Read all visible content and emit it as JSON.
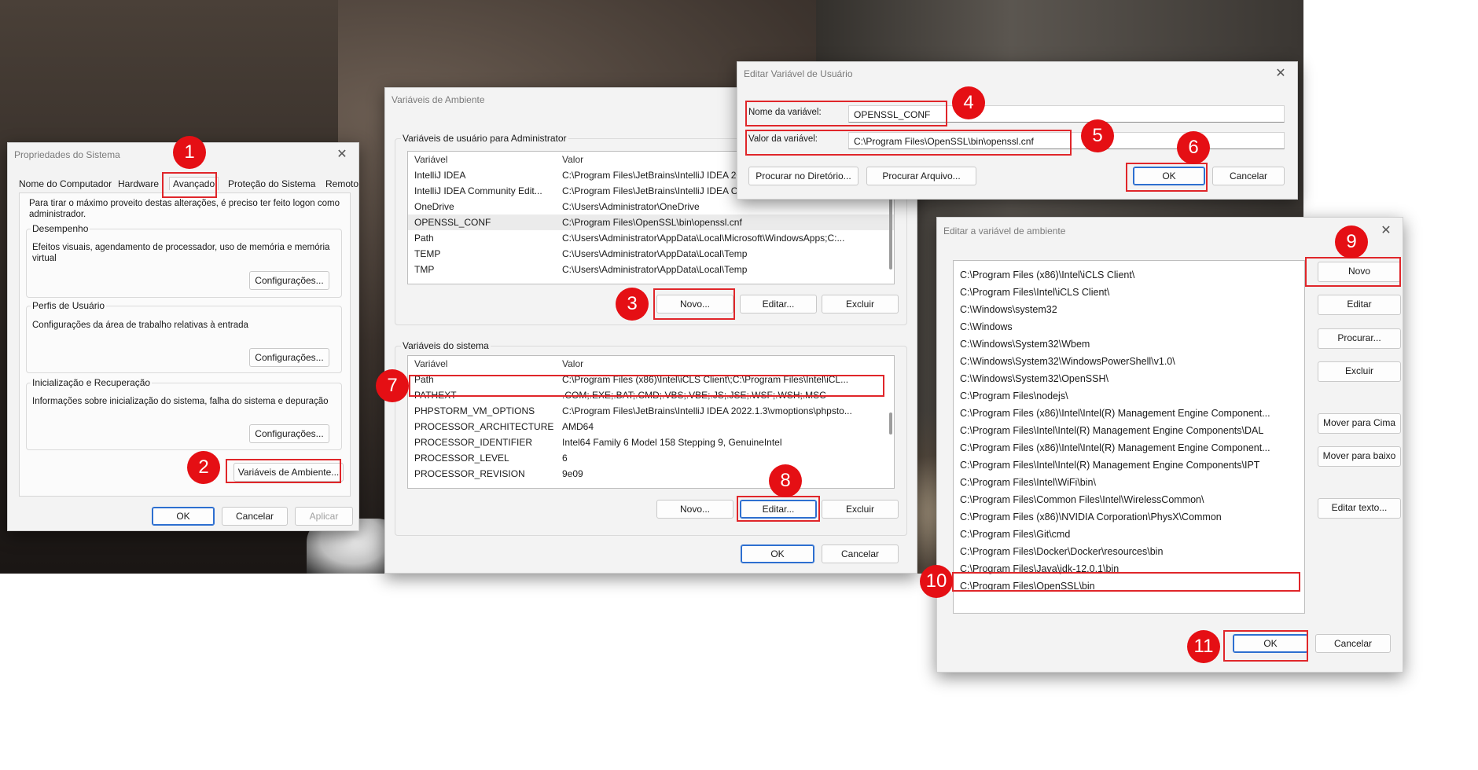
{
  "sys": {
    "title": "Propriedades do Sistema",
    "tabs": [
      "Nome do Computador",
      "Hardware",
      "Avançado",
      "Proteção do Sistema",
      "Remoto"
    ],
    "intro": "Para tirar o máximo proveito destas alterações, é preciso ter feito logon como administrador.",
    "perf_label": "Desempenho",
    "perf_desc": "Efeitos visuais, agendamento de processador, uso de memória e memória virtual",
    "profiles_label": "Perfis de Usuário",
    "profiles_desc": "Configurações da área de trabalho relativas à entrada",
    "startup_label": "Inicialização e Recuperação",
    "startup_desc": "Informações sobre inicialização do sistema, falha do sistema e depuração",
    "settings_btn": "Configurações...",
    "env_btn": "Variáveis de Ambiente...",
    "ok": "OK",
    "cancel": "Cancelar",
    "apply": "Aplicar"
  },
  "env": {
    "title": "Variáveis de Ambiente",
    "user_group": "Variáveis de usuário para Administrator",
    "col_var": "Variável",
    "col_val": "Valor",
    "user_vars": [
      {
        "name": "IntelliJ IDEA",
        "value": "C:\\Program Files\\JetBrains\\IntelliJ IDEA 2022.1.3\\bin;"
      },
      {
        "name": "IntelliJ IDEA Community Edit...",
        "value": "C:\\Program Files\\JetBrains\\IntelliJ IDEA Community Edition 2021.3.3\\bin;"
      },
      {
        "name": "OneDrive",
        "value": "C:\\Users\\Administrator\\OneDrive"
      },
      {
        "name": "OPENSSL_CONF",
        "value": "C:\\Program Files\\OpenSSL\\bin\\openssl.cnf"
      },
      {
        "name": "Path",
        "value": "C:\\Users\\Administrator\\AppData\\Local\\Microsoft\\WindowsApps;C:..."
      },
      {
        "name": "TEMP",
        "value": "C:\\Users\\Administrator\\AppData\\Local\\Temp"
      },
      {
        "name": "TMP",
        "value": "C:\\Users\\Administrator\\AppData\\Local\\Temp"
      }
    ],
    "system_group": "Variáveis do sistema",
    "system_vars": [
      {
        "name": "Path",
        "value": "C:\\Program Files (x86)\\Intel\\iCLS Client\\;C:\\Program Files\\Intel\\iCL..."
      },
      {
        "name": "PATHEXT",
        "value": ".COM;.EXE;.BAT;.CMD;.VBS;.VBE;.JS;.JSE;.WSF;.WSH;.MSC"
      },
      {
        "name": "PHPSTORM_VM_OPTIONS",
        "value": "C:\\Program Files\\JetBrains\\IntelliJ IDEA 2022.1.3\\vmoptions\\phpsto..."
      },
      {
        "name": "PROCESSOR_ARCHITECTURE",
        "value": "AMD64"
      },
      {
        "name": "PROCESSOR_IDENTIFIER",
        "value": "Intel64 Family 6 Model 158 Stepping 9, GenuineIntel"
      },
      {
        "name": "PROCESSOR_LEVEL",
        "value": "6"
      },
      {
        "name": "PROCESSOR_REVISION",
        "value": "9e09"
      }
    ],
    "new": "Novo...",
    "edit": "Editar...",
    "delete": "Excluir",
    "ok": "OK",
    "cancel": "Cancelar"
  },
  "editvar": {
    "title": "Editar Variável de Usuário",
    "name_label": "Nome da variável:",
    "name_value": "OPENSSL_CONF",
    "value_label": "Valor da variável:",
    "value_value": "C:\\Program Files\\OpenSSL\\bin\\openssl.cnf",
    "browse_dir": "Procurar no Diretório...",
    "browse_file": "Procurar Arquivo...",
    "ok": "OK",
    "cancel": "Cancelar"
  },
  "editpath": {
    "title": "Editar a variável de ambiente",
    "entries": [
      "C:\\Program Files (x86)\\Intel\\iCLS Client\\",
      "C:\\Program Files\\Intel\\iCLS Client\\",
      "C:\\Windows\\system32",
      "C:\\Windows",
      "C:\\Windows\\System32\\Wbem",
      "C:\\Windows\\System32\\WindowsPowerShell\\v1.0\\",
      "C:\\Windows\\System32\\OpenSSH\\",
      "C:\\Program Files\\nodejs\\",
      "C:\\Program Files (x86)\\Intel\\Intel(R) Management Engine Component...",
      "C:\\Program Files\\Intel\\Intel(R) Management Engine Components\\DAL",
      "C:\\Program Files (x86)\\Intel\\Intel(R) Management Engine Component...",
      "C:\\Program Files\\Intel\\Intel(R) Management Engine Components\\IPT",
      "C:\\Program Files\\Intel\\WiFi\\bin\\",
      "C:\\Program Files\\Common Files\\Intel\\WirelessCommon\\",
      "C:\\Program Files (x86)\\NVIDIA Corporation\\PhysX\\Common",
      "C:\\Program Files\\Git\\cmd",
      "C:\\Program Files\\Docker\\Docker\\resources\\bin",
      "C:\\Program Files\\Java\\jdk-12.0.1\\bin",
      "C:\\Program Files\\OpenSSL\\bin"
    ],
    "buttons": [
      "Novo",
      "Editar",
      "Procurar...",
      "Excluir",
      "Mover para Cima",
      "Mover para baixo",
      "Editar texto..."
    ],
    "ok": "OK",
    "cancel": "Cancelar"
  },
  "steps": [
    "1",
    "2",
    "3",
    "4",
    "5",
    "6",
    "7",
    "8",
    "9",
    "10",
    "11"
  ],
  "colors": {
    "accent": "#e50f14",
    "highlight": "#e0262a",
    "primary_border": "#2d6fd0"
  }
}
